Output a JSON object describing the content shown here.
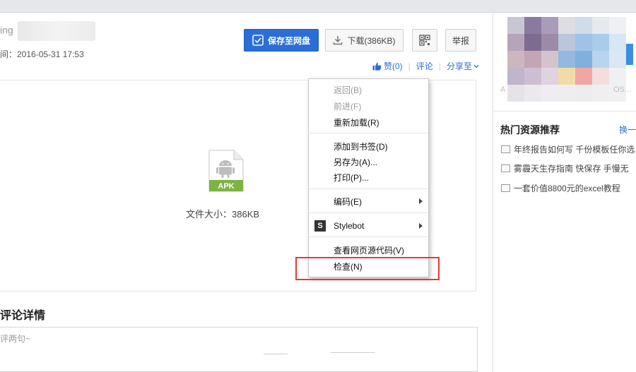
{
  "header": {
    "title_fragment": "ing",
    "upload_time": "间：2016-05-31 17:53"
  },
  "toolbar": {
    "save_label": "保存至网盘",
    "download_label": "下载(386KB)",
    "report_label": "举报"
  },
  "actions": {
    "like_label": "赞(0)",
    "comment_label": "评论",
    "share_label": "分享至"
  },
  "preview": {
    "file_type": "APK",
    "file_size": "文件大小：386KB"
  },
  "comments": {
    "title": "评论详情",
    "placeholder": "评两句~"
  },
  "context_menu": {
    "back": "返回(B)",
    "forward": "前进(F)",
    "reload": "重新加载(R)",
    "bookmark": "添加到书签(D)",
    "save_as": "另存为(A)...",
    "print": "打印(P)...",
    "encoding": "编码(E)",
    "extension_icon": "S",
    "stylebot": "Stylebot",
    "view_source": "查看网页源代码(V)",
    "inspect": "检查(N)"
  },
  "sidebar": {
    "mosaic_left": "A",
    "mosaic_right": "OS...",
    "hot_title": "热门资源推荐",
    "change_label": "换一",
    "items": [
      "年终报告如何写 千份模板任你选",
      "雾霾天生存指南 快保存 手慢无",
      "一套价值8800元的excel教程"
    ]
  },
  "colors": {
    "accent": "#2b6ed6",
    "highlight": "#e53935"
  }
}
